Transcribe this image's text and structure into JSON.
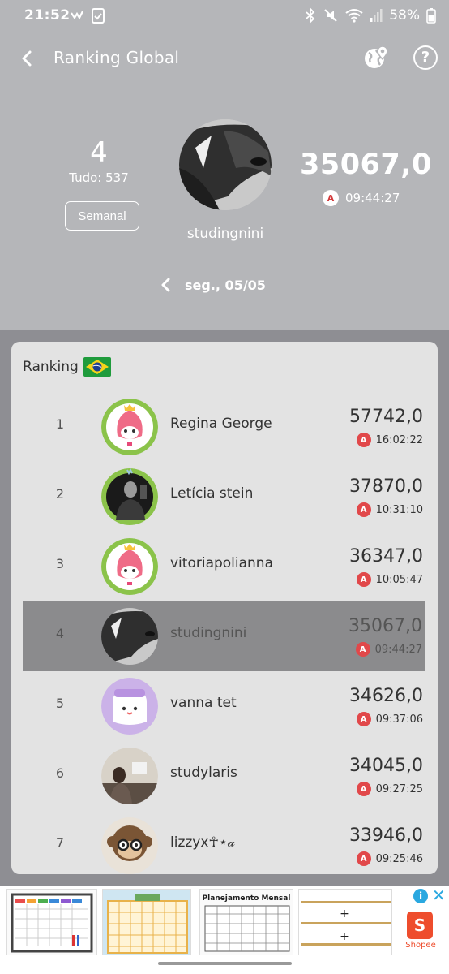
{
  "status_bar": {
    "time": "21:52",
    "battery": "58%"
  },
  "topbar": {
    "title": "Ranking Global"
  },
  "summary": {
    "rank": "4",
    "total_label": "Tudo: 537",
    "period_button": "Semanal",
    "username": "studingnini",
    "score": "35067,0",
    "time": "09:44:27",
    "date_label": "seg., 05/05"
  },
  "ranking": {
    "title": "Ranking",
    "country_flag": "flag-brazil-icon",
    "badge_letter": "A",
    "rows": [
      {
        "pos": "1",
        "name": "Regina George",
        "score": "57742,0",
        "time": "16:02:22",
        "avatar": "pink-mascot-crown",
        "current": false
      },
      {
        "pos": "2",
        "name": "Letícia stein",
        "score": "37870,0",
        "time": "10:31:10",
        "avatar": "dark-photo",
        "current": false
      },
      {
        "pos": "3",
        "name": "vitoriapolianna",
        "score": "36347,0",
        "time": "10:05:47",
        "avatar": "pink-mascot-crown",
        "current": false
      },
      {
        "pos": "4",
        "name": "studingnini",
        "score": "35067,0",
        "time": "09:44:27",
        "avatar": "grey-photo",
        "current": true
      },
      {
        "pos": "5",
        "name": "vanna tet",
        "score": "34626,0",
        "time": "09:37:06",
        "avatar": "lilac-mascot",
        "current": false
      },
      {
        "pos": "6",
        "name": "studylaris",
        "score": "34045,0",
        "time": "09:27:25",
        "avatar": "desk-photo",
        "current": false
      },
      {
        "pos": "7",
        "name": "lizzyx☥⋆𝒶",
        "score": "33946,0",
        "time": "09:25:46",
        "avatar": "monkey-glasses",
        "current": false
      }
    ]
  },
  "ad": {
    "title": "Planejamento Mensal",
    "brand": "Shopee",
    "brand_color": "#ee4d2d",
    "info_color": "#2aa8e0"
  },
  "colors": {
    "header_bg": "#b5b6b9",
    "card_bg": "#e3e3e3",
    "current_row_bg": "#8b8b8d",
    "badge_red": "#e1484a"
  }
}
